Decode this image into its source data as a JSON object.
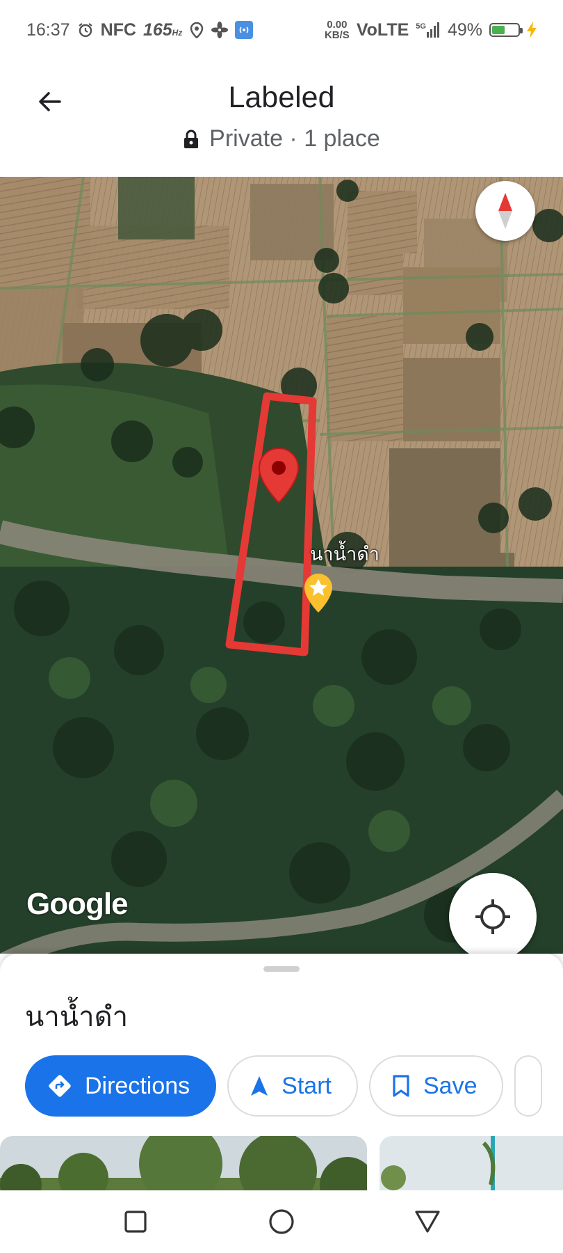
{
  "status_bar": {
    "time": "16:37",
    "nfc": "NFC",
    "refresh_rate": "165",
    "refresh_unit": "Hz",
    "net_speed_value": "0.00",
    "net_speed_unit": "KB/S",
    "volte": "VoLTE",
    "network": "5G",
    "battery_percent": "49%",
    "battery_level": 0.49,
    "icons": [
      "alarm-icon",
      "location-icon",
      "fan-icon",
      "hotspot-icon",
      "signal-icon",
      "battery-icon",
      "charging-icon"
    ]
  },
  "header": {
    "title": "Labeled",
    "subtitle": "Private · 1 place",
    "back_icon": "arrow-left-icon",
    "lock_icon": "lock-icon"
  },
  "map": {
    "place_label": "นาน้ำดำ",
    "google_logo": "Google",
    "compass_icon": "compass-icon",
    "locate_icon": "my-location-icon",
    "accent": "#e53935",
    "star_color": "#fbc02d"
  },
  "sheet": {
    "place_name": "นาน้ำดำ",
    "actions": [
      {
        "label": "Directions",
        "icon": "directions-icon"
      },
      {
        "label": "Start",
        "icon": "navigation-icon"
      },
      {
        "label": "Save",
        "icon": "bookmark-icon"
      }
    ]
  },
  "nav": {
    "recent_icon": "square-icon",
    "home_icon": "circle-icon",
    "back_icon": "triangle-icon"
  }
}
